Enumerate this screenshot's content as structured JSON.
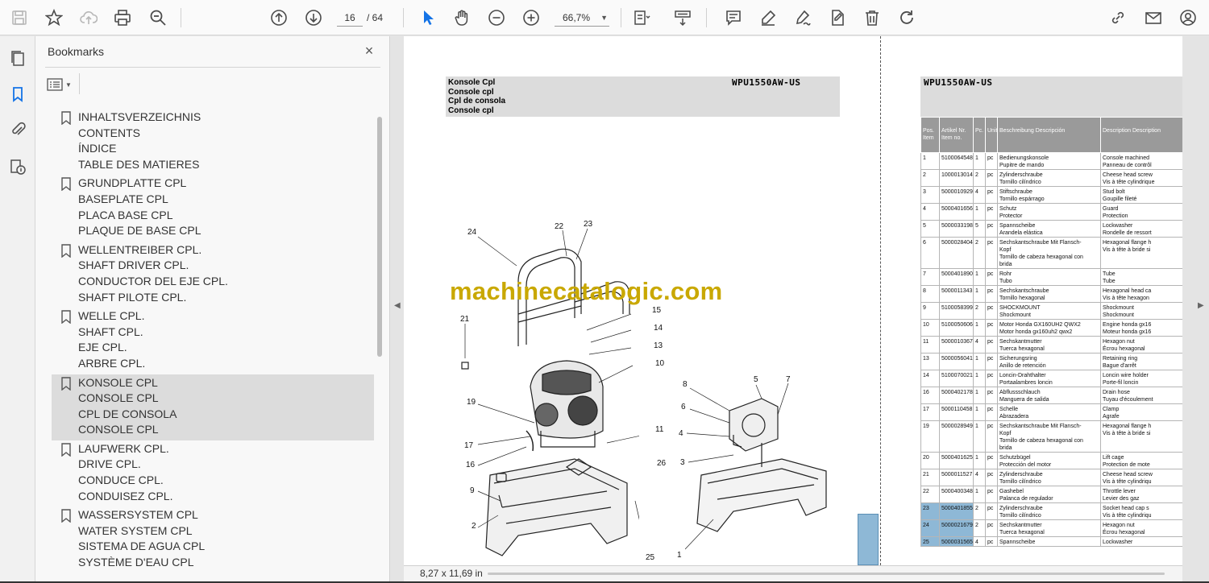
{
  "toolbar": {
    "page_current": "16",
    "page_total": "/ 64",
    "zoom": "66,7%",
    "icons": [
      "save-icon",
      "star-icon",
      "upload-cloud-icon",
      "print-icon",
      "zoom-search-icon",
      "page-up-icon",
      "page-down-icon",
      "select-pointer-icon",
      "hand-pan-icon",
      "zoom-out-icon",
      "zoom-in-icon",
      "fit-page-icon",
      "scroll-mode-icon",
      "comment-icon",
      "highlight-pen-icon",
      "sign-icon",
      "stamp-icon",
      "delete-icon",
      "rotate-icon",
      "share-link-icon",
      "mail-icon",
      "account-icon"
    ]
  },
  "rail": {
    "icons": [
      "pages-icon",
      "bookmark-icon",
      "attachment-icon",
      "document-info-icon"
    ]
  },
  "bookmarks": {
    "title": "Bookmarks",
    "close": "×",
    "groups": [
      {
        "lines": [
          "INHALTSVERZEICHNIS",
          "CONTENTS",
          "ÍNDICE",
          "TABLE DES MATIERES"
        ],
        "selected": false
      },
      {
        "lines": [
          "GRUNDPLATTE CPL",
          "BASEPLATE CPL",
          "PLACA BASE CPL",
          "PLAQUE DE BASE CPL"
        ],
        "selected": false
      },
      {
        "lines": [
          "WELLENTREIBER CPL.",
          "SHAFT DRIVER CPL.",
          "CONDUCTOR DEL EJE CPL.",
          "SHAFT PILOTE CPL."
        ],
        "selected": false
      },
      {
        "lines": [
          "WELLE CPL.",
          "SHAFT CPL.",
          "EJE CPL.",
          "ARBRE CPL."
        ],
        "selected": false
      },
      {
        "lines": [
          "KONSOLE CPL",
          "CONSOLE CPL",
          "CPL DE CONSOLA",
          "CONSOLE CPL"
        ],
        "selected": true
      },
      {
        "lines": [
          "LAUFWERK CPL.",
          "DRIVE CPL.",
          "CONDUCE CPL.",
          "CONDUISEZ CPL."
        ],
        "selected": false
      },
      {
        "lines": [
          "WASSERSYSTEM CPL",
          "WATER SYSTEM CPL",
          "SISTEMA DE AGUA CPL",
          "SYSTÈME D'EAU CPL"
        ],
        "selected": false
      }
    ]
  },
  "document": {
    "left_title": [
      "Konsole Cpl",
      "Console cpl",
      "Cpl de consola",
      "Console cpl"
    ],
    "model": "WPU1550AW-US",
    "watermark": "machinecatalogic.com",
    "callouts_left": [
      "24",
      "22",
      "23",
      "21",
      "15",
      "14",
      "13",
      "10",
      "19",
      "17",
      "16",
      "9",
      "2",
      "11",
      "26",
      "25"
    ],
    "callouts_right": [
      "8",
      "6",
      "4",
      "3",
      "5",
      "7",
      "1"
    ],
    "table_headers": [
      "Pos. Item",
      "Artikel Nr. Item no.",
      "Pc.",
      "Unit",
      "Beschreibung Descripción",
      "Description Description"
    ],
    "table_rows": [
      [
        "1",
        "5100064548",
        "1",
        "pc",
        "Bedienungskonsole|Pupitre de mando",
        "Console machined|Panneau de contrôl"
      ],
      [
        "2",
        "1000013014",
        "2",
        "pc",
        "Zylinderschraube|Tornillo cilíndrico",
        "Cheese head screw|Vis à tête cylindrique"
      ],
      [
        "3",
        "5000010929",
        "4",
        "pc",
        "Stiftschraube|Tornillo espárrago",
        "Stud bolt|Goupille fileté"
      ],
      [
        "4",
        "5000401656",
        "1",
        "pc",
        "Schutz|Protector",
        "Guard|Protection"
      ],
      [
        "5",
        "5000033198",
        "5",
        "pc",
        "Spannscheibe|Arandela elástica",
        "Lockwasher|Rondelle de ressort"
      ],
      [
        "6",
        "5000028404",
        "2",
        "pc",
        "Sechskantschraube Mit Flansch-|Kopf|Tornillo de cabeza hexagonal con|brida",
        "Hexagonal flange h|Vis à tête à bride si"
      ],
      [
        "7",
        "5000401890",
        "1",
        "pc",
        "Rohr|Tubo",
        "Tube|Tube"
      ],
      [
        "8",
        "5000011343",
        "1",
        "pc",
        "Sechskantschraube|Tornillo hexagonal",
        "Hexagonal head ca|Vis à tête hexagon"
      ],
      [
        "9",
        "5100058399",
        "2",
        "pc",
        "SHOCKMOUNT|Shockmount",
        "Shockmount|Shockmount"
      ],
      [
        "10",
        "5100050606",
        "1",
        "pc",
        "Motor Honda GX160UH2 QWX2|Motor honda gx160uh2 qwx2",
        "Engine honda gx16|Moteur honda gx16"
      ],
      [
        "11",
        "5000010367",
        "4",
        "pc",
        "Sechskantmutter|Tuerca hexagonal",
        "Hexagon nut|Écrou hexagonal"
      ],
      [
        "13",
        "5000056041",
        "1",
        "pc",
        "Sicherungsring|Anillo de retención",
        "Retaining ring|Bague d'arrêt"
      ],
      [
        "14",
        "5100070021",
        "1",
        "pc",
        "Loncin-Drahthalter|Portaalambres loncin",
        "Loncin wire holder|Porte-fil loncin"
      ],
      [
        "16",
        "5000402178",
        "1",
        "pc",
        "Abflussschlauch|Manguera de salida",
        "Drain hose|Tuyau d'écoulement"
      ],
      [
        "17",
        "5000110458",
        "1",
        "pc",
        "Schelle|Abrazadera",
        "Clamp|Agrafe"
      ],
      [
        "19",
        "5000028949",
        "1",
        "pc",
        "Sechskantschraube Mit Flansch-|Kopf|Tornillo de cabeza hexagonal con|brida",
        "Hexagonal flange h|Vis à tête à bride si"
      ],
      [
        "20",
        "5000401625",
        "1",
        "pc",
        "Schutzbügel|Protección del motor",
        "Lift cage|Protection de mote"
      ],
      [
        "21",
        "5000011527",
        "4",
        "pc",
        "Zylinderschraube|Tornillo cilíndrico",
        "Cheese head screw|Vis à tête cylindriqu"
      ],
      [
        "22",
        "5000400348",
        "1",
        "pc",
        "Gashebel|Palanca de regulador",
        "Throttle lever|Levier des gaz"
      ],
      [
        "23",
        "5000401855",
        "2",
        "pc",
        "Zylinderschraube|Tornillo cilíndrico",
        "Socket head cap s|Vis à tête cylindriqu"
      ],
      [
        "24",
        "5000021679",
        "2",
        "pc",
        "Sechskantmutter|Tuerca hexagonal",
        "Hexagon nut|Écrou hexagonal"
      ],
      [
        "25",
        "5000031565",
        "4",
        "pc",
        "Spannscheibe|",
        "Lockwasher|"
      ]
    ]
  },
  "status": {
    "page_size": "8,27 x 11,69 in"
  }
}
